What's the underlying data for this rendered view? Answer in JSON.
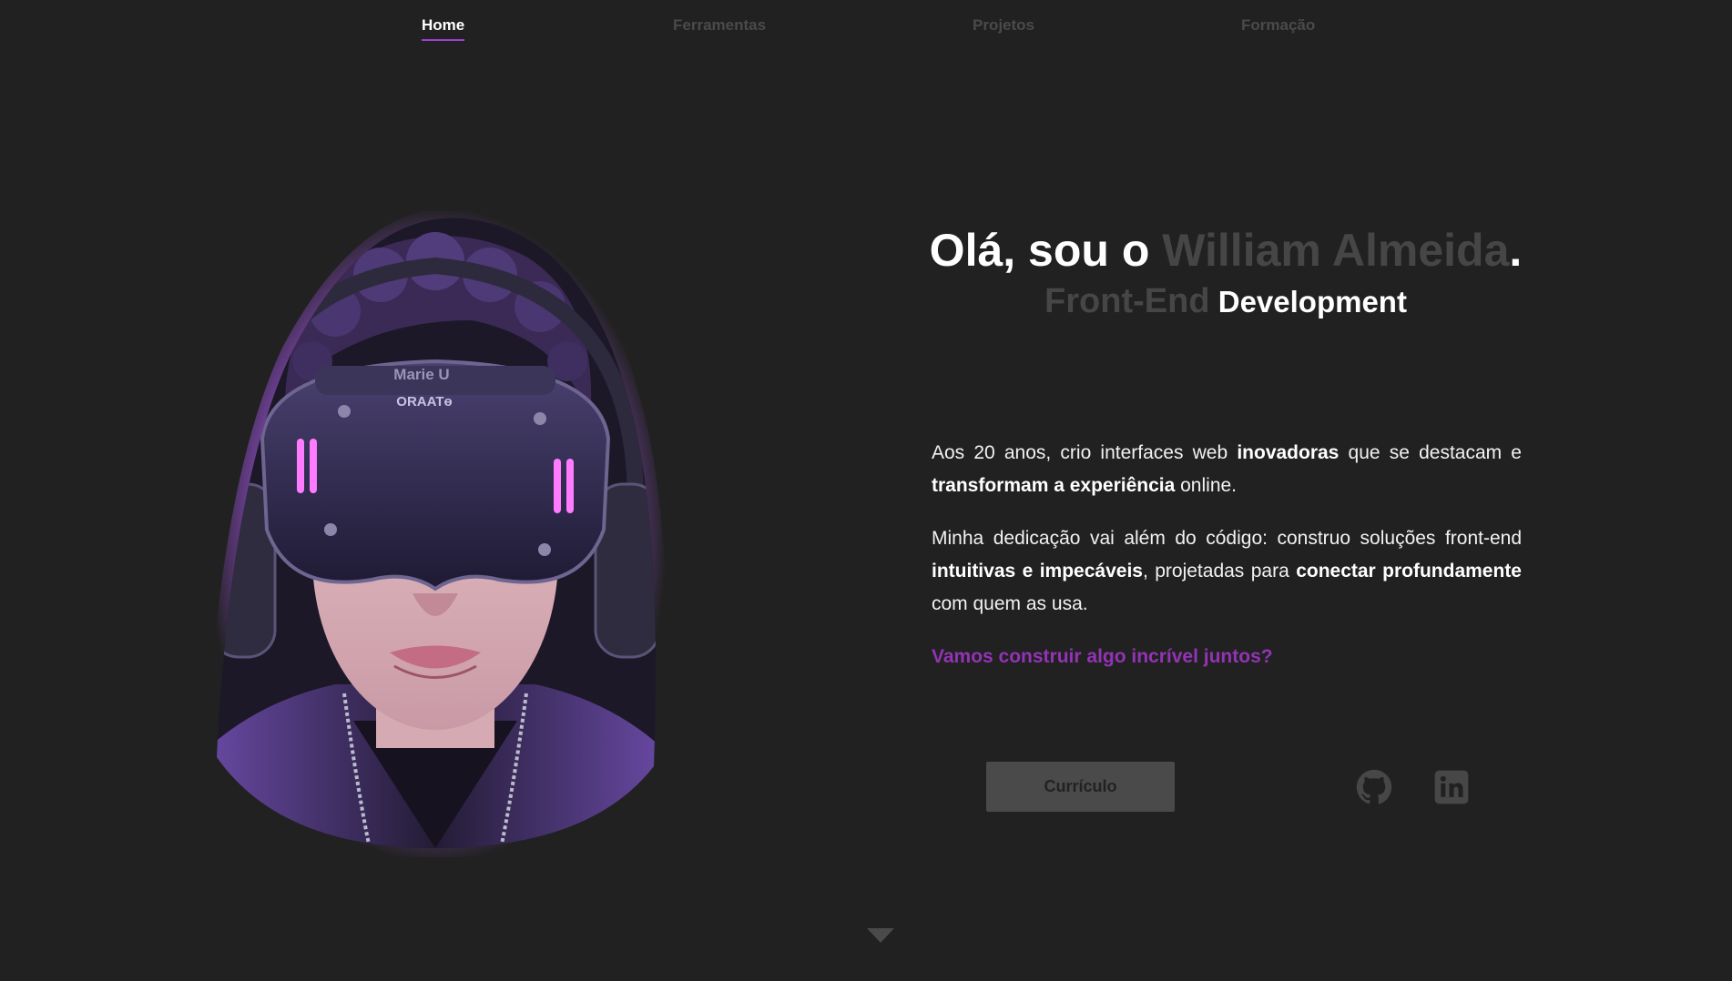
{
  "nav": {
    "items": [
      {
        "label": "Home",
        "active": true
      },
      {
        "label": "Ferramentas",
        "active": false
      },
      {
        "label": "Projetos",
        "active": false
      },
      {
        "label": "Formação",
        "active": false
      }
    ]
  },
  "avatar": {
    "headset_brand": "Marie U",
    "headset_model": "ORAATɵ"
  },
  "hero": {
    "greeting": "Olá, sou o ",
    "name": "William Almeida",
    "period": ".",
    "role_muted": "Front-End",
    "role": "Development"
  },
  "about": {
    "p1": {
      "t1": "Aos 20 anos, crio interfaces web ",
      "b1": "inovadoras",
      "t2": " que se destacam e ",
      "b2": "transformam a experiência",
      "t3": " online."
    },
    "p2": {
      "t1": "Minha dedicação vai além do código: construo soluções front-end ",
      "b1": "intuitivas e impecáveis",
      "t2": ", projetadas para ",
      "b2": "conectar profundamente",
      "t3": " com quem as usa."
    },
    "cta": "Vamos construir algo incrível juntos?"
  },
  "actions": {
    "cv_label": "Currículo"
  },
  "colors": {
    "background": "#212121",
    "accent": "#9b3fd6",
    "muted_text": "#464646",
    "icon": "#474747"
  },
  "icons": [
    "github-icon",
    "linkedin-icon",
    "chevron-down-icon"
  ]
}
